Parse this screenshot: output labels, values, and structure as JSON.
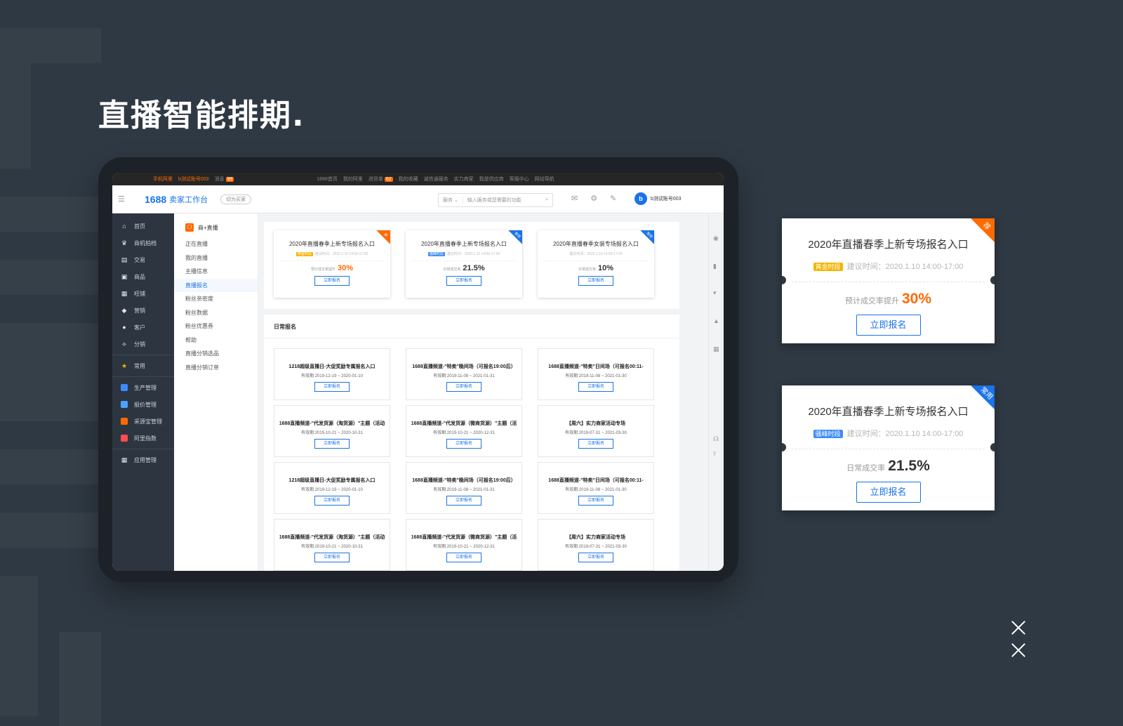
{
  "slide": {
    "title": "直播智能排期."
  },
  "colors": {
    "background": "#2f3943",
    "accent_blue": "#1a73e8",
    "accent_orange": "#ff6a00",
    "tag_gold": "#f5b400"
  },
  "topbar": {
    "mobile": "手机阿里",
    "account": "b测试账号003",
    "messages": "消息",
    "messages_count": "99",
    "items": [
      "1688首页",
      "我的阿里",
      "进货单",
      "我的收藏",
      "诚信通服务",
      "实力商家",
      "我是供应商",
      "客服中心",
      "网站导航"
    ],
    "cart_count": "62"
  },
  "header": {
    "logo": "1688",
    "logo_sub": "卖家工作台",
    "switch_label": "切为买家",
    "search_service": "服务",
    "search_placeholder": "输入服务或您需要的功能",
    "user_name": "b测试账号003"
  },
  "leftnav": {
    "items": [
      "首页",
      "商机拍档",
      "交易",
      "商品",
      "旺铺",
      "营销",
      "客户",
      "分销"
    ],
    "common": "常用",
    "apps": [
      "生产管理",
      "报价管理",
      "采源宝管理",
      "阿里指数"
    ],
    "app_manage": "应用管理"
  },
  "subnav": {
    "title": "商+直播",
    "items": [
      "正在直播",
      "我的直播",
      "主播信息",
      "直播报名",
      "粉丝亲密度",
      "粉丝数据",
      "粉丝优惠券",
      "帮助",
      "直播分销选品",
      "直播分销订单"
    ],
    "active": "直播报名"
  },
  "top_cards": [
    {
      "title": "2020年直播春季上新专场报名入口",
      "tag": "黄金时段",
      "time": "建议时间：2020.1.10 14:00-17:00",
      "metric_label": "预计成交率提升",
      "metric_value": "30%",
      "button": "立即报名",
      "corner": "荐"
    },
    {
      "title": "2020年直播春季上新专场报名入口",
      "tag": "骚峰时段",
      "time": "建议时间：2020.1.10 14:00-17:00",
      "metric_label": "日常成交率",
      "metric_value": "21.5%",
      "button": "立即报名",
      "corner": "常用"
    },
    {
      "title": "2020年直播春季女装专场报名入口",
      "tag": "",
      "time": "建议时间：2020.1.10 14:00-17:00",
      "metric_label": "日常成交率",
      "metric_value": "10%",
      "button": "立即报名",
      "corner": "常用"
    }
  ],
  "daily": {
    "title": "日常报名",
    "cards": [
      {
        "title": "1218超级直播日-大促奖励专属报名入口",
        "valid": "有效期:2019-12-19 ~ 2020-01-10",
        "button": "立即报名"
      },
      {
        "title": "1688直播频道-\"特卖\"晚间场（可报名19:00后）",
        "valid": "有效期:2019-11-08 ~ 2021-01-31",
        "button": "立即报名"
      },
      {
        "title": "1688直播频道-\"特卖\"日间场（可报名00:11-",
        "valid": "有效期:2019-11-08 ~ 2021-01-30",
        "button": "立即报名"
      },
      {
        "title": "1688直播频道-\"代发货源（淘货源）\"主题（活动",
        "valid": "有效期:2019-10-21 ~ 2020-10-31",
        "button": "立即报名"
      },
      {
        "title": "1688直播频道-\"代发货源（微商货源）\"主题（活",
        "valid": "有效期:2019-10-21 ~ 2020-12-31",
        "button": "立即报名"
      },
      {
        "title": "【周六】实力商家活动专场",
        "valid": "有效期:2019-07-31 ~ 2021-03-30",
        "button": "立即报名"
      },
      {
        "title": "1218超级直播日-大促奖励专属报名入口",
        "valid": "有效期:2019-12-19 ~ 2020-01-10",
        "button": "立即报名"
      },
      {
        "title": "1688直播频道-\"特卖\"晚间场（可报名19:00后）",
        "valid": "有效期:2019-11-08 ~ 2021-01-31",
        "button": "立即报名"
      },
      {
        "title": "1688直播频道-\"特卖\"日间场（可报名00:11-",
        "valid": "有效期:2019-11-08 ~ 2021-01-30",
        "button": "立即报名"
      },
      {
        "title": "1688直播频道-\"代发货源（淘货源）\"主题（活动",
        "valid": "有效期:2019-10-21 ~ 2020-10-31",
        "button": "立即报名"
      },
      {
        "title": "1688直播频道-\"代发货源（微商货源）\"主题（活",
        "valid": "有效期:2019-10-21 ~ 2020-12-31",
        "button": "立即报名"
      },
      {
        "title": "【周六】实力商家活动专场",
        "valid": "有效期:2019-07-31 ~ 2021-03-30",
        "button": "立即报名"
      }
    ]
  },
  "zoom_cards": [
    {
      "title": "2020年直播春季上新专场报名入口",
      "tag": "黄金时段",
      "time": "建议时间：2020.1.10 14:00-17:00",
      "metric_label": "预计成交率提升",
      "metric_value": "30%",
      "button": "立即报名",
      "corner": "荐"
    },
    {
      "title": "2020年直播春季上新专场报名入口",
      "tag": "骚峰时段",
      "time": "建议时间：2020.1.10 14:00-17:00",
      "metric_label": "日常成交率",
      "metric_value": "21.5%",
      "button": "立即报名",
      "corner": "常用"
    }
  ]
}
